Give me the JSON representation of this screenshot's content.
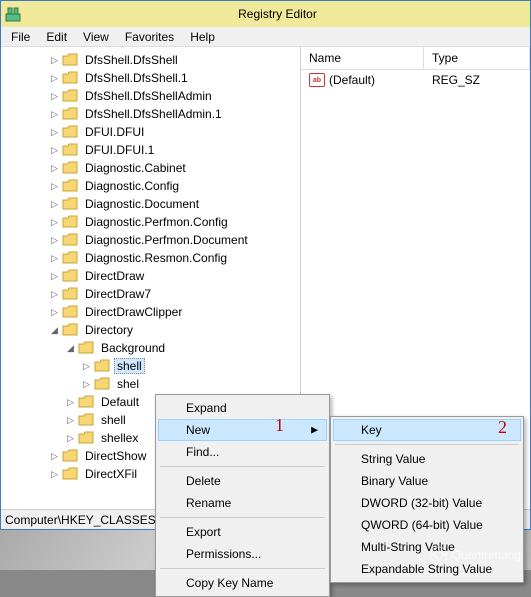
{
  "window": {
    "title": "Registry Editor"
  },
  "menu": {
    "file": "File",
    "edit": "Edit",
    "view": "View",
    "favorites": "Favorites",
    "help": "Help"
  },
  "tree": [
    {
      "depth": 0,
      "exp": "▷",
      "label": "DfsShell.DfsShell"
    },
    {
      "depth": 0,
      "exp": "▷",
      "label": "DfsShell.DfsShell.1"
    },
    {
      "depth": 0,
      "exp": "▷",
      "label": "DfsShell.DfsShellAdmin"
    },
    {
      "depth": 0,
      "exp": "▷",
      "label": "DfsShell.DfsShellAdmin.1"
    },
    {
      "depth": 0,
      "exp": "▷",
      "label": "DFUI.DFUI"
    },
    {
      "depth": 0,
      "exp": "▷",
      "label": "DFUI.DFUI.1"
    },
    {
      "depth": 0,
      "exp": "▷",
      "label": "Diagnostic.Cabinet"
    },
    {
      "depth": 0,
      "exp": "▷",
      "label": "Diagnostic.Config"
    },
    {
      "depth": 0,
      "exp": "▷",
      "label": "Diagnostic.Document"
    },
    {
      "depth": 0,
      "exp": "▷",
      "label": "Diagnostic.Perfmon.Config"
    },
    {
      "depth": 0,
      "exp": "▷",
      "label": "Diagnostic.Perfmon.Document"
    },
    {
      "depth": 0,
      "exp": "▷",
      "label": "Diagnostic.Resmon.Config"
    },
    {
      "depth": 0,
      "exp": "▷",
      "label": "DirectDraw"
    },
    {
      "depth": 0,
      "exp": "▷",
      "label": "DirectDraw7"
    },
    {
      "depth": 0,
      "exp": "▷",
      "label": "DirectDrawClipper"
    },
    {
      "depth": 0,
      "exp": "◢",
      "label": "Directory"
    },
    {
      "depth": 1,
      "exp": "◢",
      "label": "Background"
    },
    {
      "depth": 2,
      "exp": "▷",
      "label": "shell",
      "selected": true
    },
    {
      "depth": 2,
      "exp": "▷",
      "label": "shel"
    },
    {
      "depth": 1,
      "exp": "▷",
      "label": "Default"
    },
    {
      "depth": 1,
      "exp": "▷",
      "label": "shell"
    },
    {
      "depth": 1,
      "exp": "▷",
      "label": "shellex"
    },
    {
      "depth": 0,
      "exp": "▷",
      "label": "DirectShow"
    },
    {
      "depth": 0,
      "exp": "▷",
      "label": "DirectXFil"
    }
  ],
  "list": {
    "headers": {
      "name": "Name",
      "type": "Type"
    },
    "rows": [
      {
        "name": "(Default)",
        "type": "REG_SZ"
      }
    ]
  },
  "statusbar": "Computer\\HKEY_CLASSES",
  "context": {
    "expand": "Expand",
    "new": "New",
    "find": "Find...",
    "delete": "Delete",
    "rename": "Rename",
    "export": "Export",
    "permissions": "Permissions...",
    "copykey": "Copy Key Name"
  },
  "newmenu": {
    "key": "Key",
    "string": "String Value",
    "binary": "Binary Value",
    "dword": "DWORD (32-bit) Value",
    "qword": "QWORD (64-bit) Value",
    "multi": "Multi-String Value",
    "exp": "Expandable String Value"
  },
  "annotations": {
    "one": "1",
    "two": "2"
  },
  "watermark": "Quantrimang"
}
